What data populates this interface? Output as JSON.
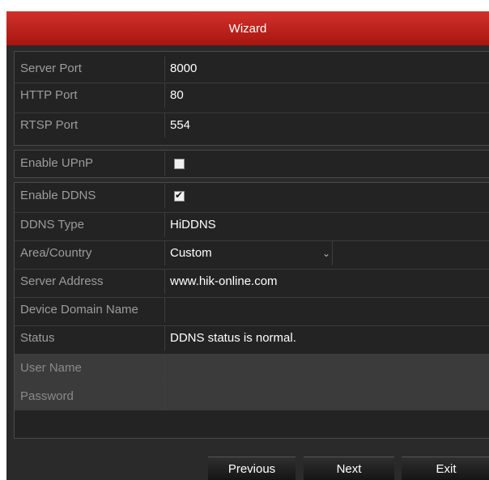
{
  "window": {
    "title": "Wizard"
  },
  "fields": {
    "server_port": {
      "label": "Server Port",
      "value": "8000"
    },
    "http_port": {
      "label": "HTTP Port",
      "value": "80"
    },
    "rtsp_port": {
      "label": "RTSP Port",
      "value": "554"
    },
    "enable_upnp": {
      "label": "Enable UPnP",
      "checked": false
    },
    "enable_ddns": {
      "label": "Enable DDNS",
      "checked": true,
      "check_glyph": "✔"
    },
    "ddns_type": {
      "label": "DDNS Type",
      "value": "HiDDNS"
    },
    "area_country": {
      "label": "Area/Country",
      "value": "Custom",
      "value2": ""
    },
    "server_address": {
      "label": "Server Address",
      "value": "www.hik-online.com"
    },
    "device_domain_name": {
      "label": "Device Domain Name",
      "value": ""
    },
    "status": {
      "label": "Status",
      "value": "DDNS status is normal."
    },
    "user_name": {
      "label": "User Name",
      "value": ""
    },
    "password": {
      "label": "Password",
      "value": ""
    }
  },
  "buttons": {
    "previous": "Previous",
    "next": "Next",
    "exit": "Exit"
  },
  "icons": {
    "dropdown": "chevron-down-icon",
    "checkbox": "checkbox-icon"
  },
  "colors": {
    "title_bar": "#c0211b",
    "panel_bg": "#232323",
    "label_text": "#9c9c9c",
    "value_text": "#ffffff"
  }
}
